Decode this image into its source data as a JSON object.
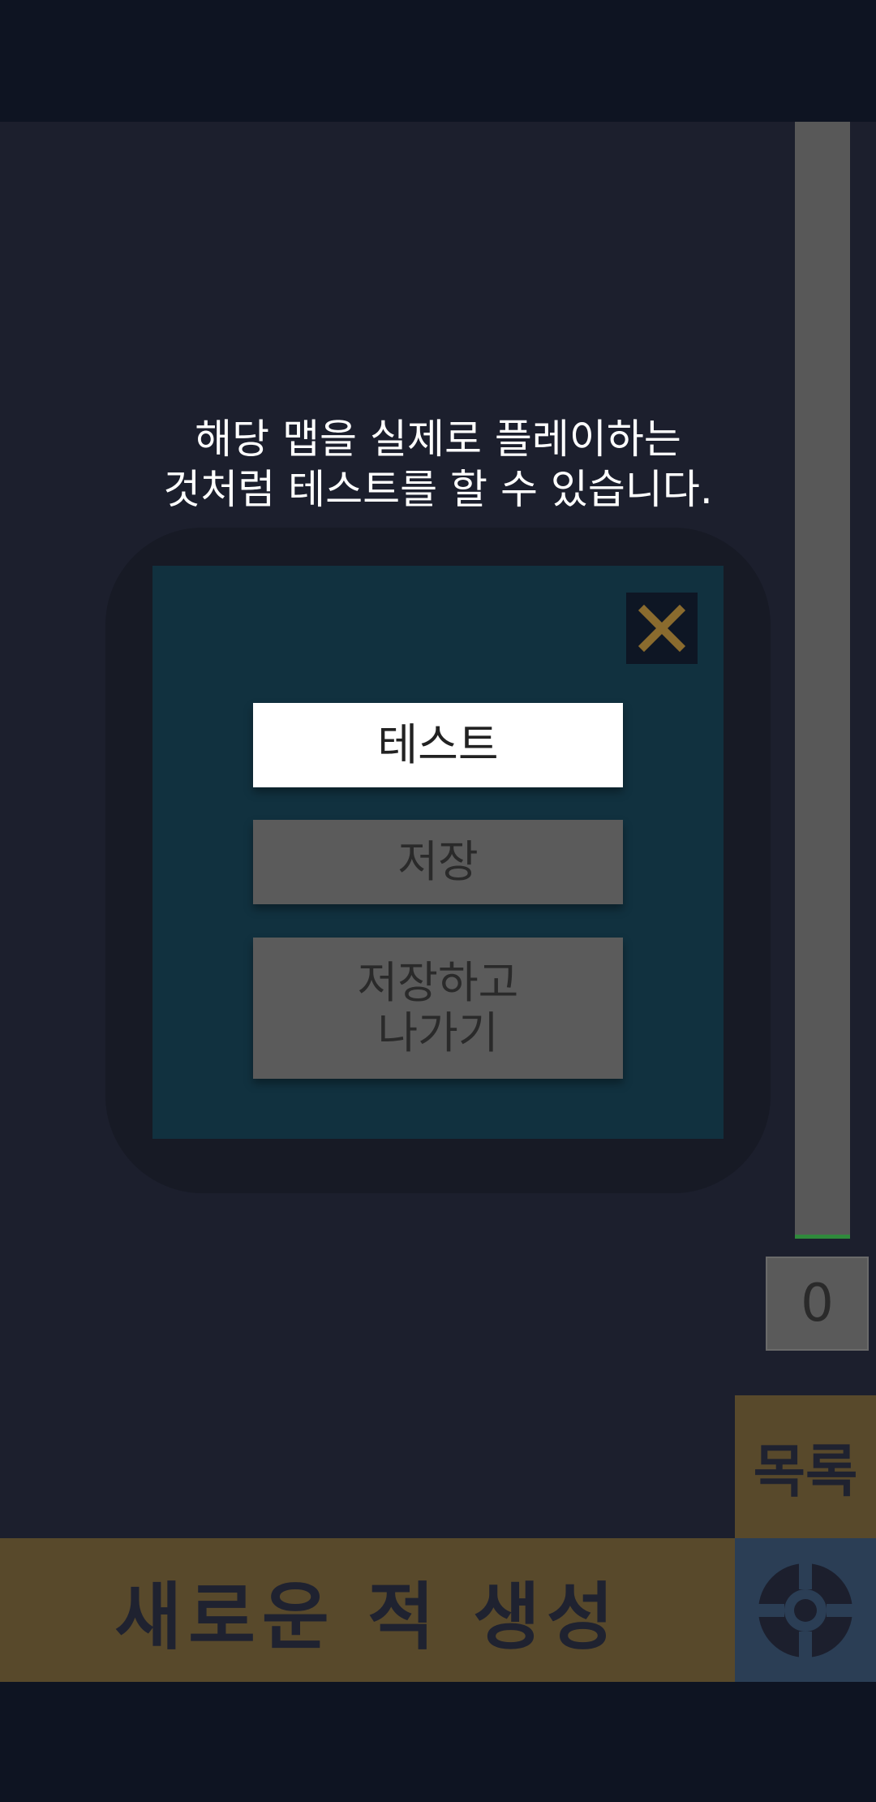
{
  "tooltip": {
    "line1": "해당 맵을 실제로 플레이하는",
    "line2": "것처럼 테스트를 할 수 있습니다."
  },
  "modal": {
    "close_icon": "close-x-icon",
    "test_label": "테스트",
    "save_label": "저장",
    "save_exit_line1": "저장하고",
    "save_exit_line2": "나가기"
  },
  "slider": {
    "value": "0"
  },
  "buttons": {
    "list_label": "목록",
    "new_enemy_label": "새로운 적 생성",
    "settings_icon": "lifebuoy-settings-icon"
  },
  "colors": {
    "background": "#1c1f2d",
    "bars": "#0e1422",
    "modal": "#11313f",
    "accent_gold": "#58492b",
    "close_x": "#8a6b2e",
    "settings_bg": "#2b3e55"
  }
}
